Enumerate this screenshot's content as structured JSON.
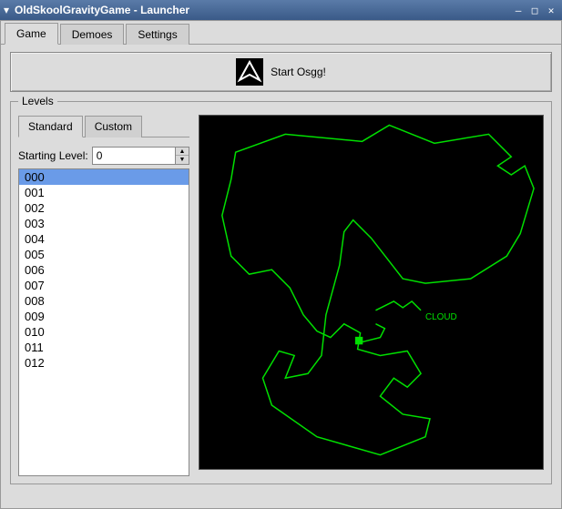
{
  "window": {
    "title": "OldSkoolGravityGame - Launcher"
  },
  "tabs": {
    "game": "Game",
    "demoes": "Demoes",
    "settings": "Settings"
  },
  "start_button": {
    "label": "Start Osgg!"
  },
  "levels": {
    "legend": "Levels",
    "subtabs": {
      "standard": "Standard",
      "custom": "Custom"
    },
    "starting_level_label": "Starting Level:",
    "starting_level_value": "0",
    "items": [
      "000",
      "001",
      "002",
      "003",
      "004",
      "005",
      "006",
      "007",
      "008",
      "009",
      "010",
      "011",
      "012"
    ],
    "selected_index": 0
  },
  "preview": {
    "annotation": "CLOUD"
  }
}
